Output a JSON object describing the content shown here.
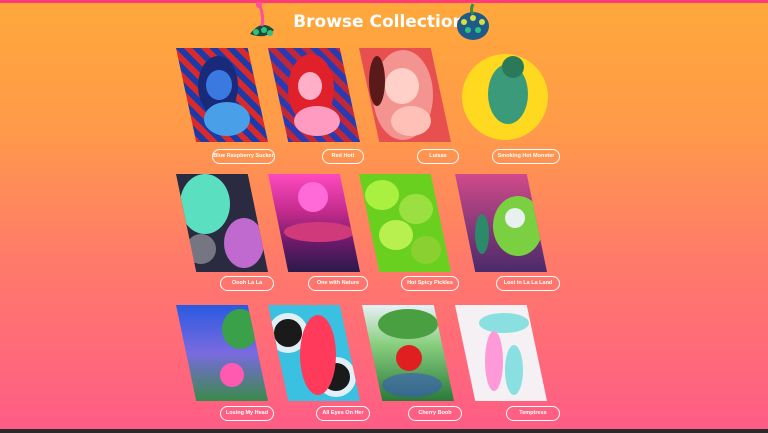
{
  "page": {
    "title": "Browse Collections"
  },
  "collections": [
    {
      "label": "Blue Raspberry Sucker",
      "icon": "blue-woman-art-icon"
    },
    {
      "label": "Red Hott",
      "icon": "red-hair-woman-art-icon"
    },
    {
      "label": "Luisas",
      "icon": "multi-eye-woman-art-icon"
    },
    {
      "label": "Smoking Hot Monster",
      "icon": "green-monster-art-icon"
    },
    {
      "label": "Oooh La La",
      "icon": "mint-figure-art-icon"
    },
    {
      "label": "One with Nature",
      "icon": "pink-sunset-art-icon"
    },
    {
      "label": "Hot Spicy Pickles",
      "icon": "green-pickles-art-icon"
    },
    {
      "label": "Lost in La La Land",
      "icon": "green-eye-creature-art-icon"
    },
    {
      "label": "Losing My Head",
      "icon": "landscape-tree-art-icon"
    },
    {
      "label": "All Eyes On Her",
      "icon": "eyes-woman-art-icon"
    },
    {
      "label": "Cherry Boob",
      "icon": "cherry-tree-art-icon"
    },
    {
      "label": "Temptress",
      "icon": "serpent-creature-art-icon"
    }
  ],
  "colors": {
    "accent_top": "#ff3c78",
    "gradient_top": "#ffa83a",
    "gradient_bottom": "#ff5c86"
  }
}
